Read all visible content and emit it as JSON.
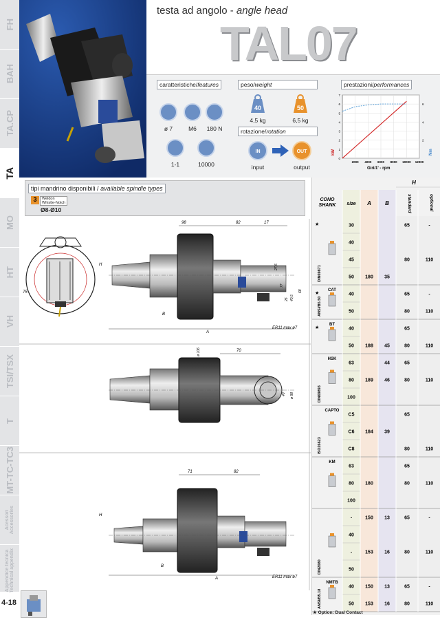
{
  "nav": {
    "tabs": [
      "FH",
      "BAH",
      "TA.CP",
      "TA",
      "MO",
      "HT",
      "VH",
      "TSI/TSX",
      "T",
      "MT-TC-TC3",
      "Acessori\nAccessories",
      "Appendice tecnica\nTechnical appendix"
    ],
    "active": "TA",
    "page_number": "4-18"
  },
  "header": {
    "subtitle_it": "testa ad angolo -",
    "subtitle_en": "angle head",
    "model": "TAL07"
  },
  "features": {
    "title_it": "caratteristiche/",
    "title_en": "features",
    "items": [
      "ø 7",
      "M6",
      "180 N",
      "1-1",
      "10000"
    ],
    "icons": [
      "collet-icon",
      "thread-icon",
      "force-icon",
      "ratio-icon",
      "rpm-icon"
    ]
  },
  "weight": {
    "title_it": "peso/",
    "title_en": "weight",
    "items": [
      "4,5 kg",
      "6,5 kg"
    ],
    "badges": [
      "40",
      "50"
    ]
  },
  "rotation": {
    "title_it": "rotazione/",
    "title_en": "rotation",
    "input": "input",
    "output": "output",
    "badge_in": "IN",
    "badge_out": "OUT"
  },
  "performance": {
    "title_it": "prestazioni/",
    "title_en": "performances",
    "xlabel": "Giri/1' - rpm",
    "ylabel_left": "kW",
    "ylabel_right": "Nm"
  },
  "chart_data": {
    "type": "line",
    "x": [
      0,
      2000,
      4000,
      6000,
      8000,
      10000,
      12000
    ],
    "xlim": [
      0,
      12000
    ],
    "xticks": [
      "2000",
      "4000",
      "6000",
      "8000",
      "10000",
      "12000"
    ],
    "ylim_left": [
      0,
      7
    ],
    "yticks_left": [
      "0",
      "1",
      "2",
      "3",
      "4",
      "5",
      "6",
      "7"
    ],
    "ylim_right": [
      0,
      7
    ],
    "yticks_right": [
      "2",
      "4",
      "6"
    ],
    "series": [
      {
        "axis": "left",
        "color": "#d42a2a",
        "points": [
          [
            0,
            0
          ],
          [
            10000,
            6.3
          ]
        ]
      },
      {
        "axis": "right",
        "color": "#5aa0d8",
        "dashed": true,
        "points": [
          [
            0,
            5.2
          ],
          [
            2000,
            5.7
          ],
          [
            4000,
            5.9
          ],
          [
            6000,
            6
          ],
          [
            8000,
            6
          ],
          [
            10000,
            6
          ]
        ]
      }
    ]
  },
  "spindle": {
    "title_it": "tipi mandrino disponibili /",
    "title_en": "available spindle types",
    "badge": "3",
    "badge_text": "Weldon\nWhistle-Notch",
    "range": "Ø8-Ø10"
  },
  "drawings": {
    "dims1": [
      "98",
      "82",
      "17",
      "H",
      "B",
      "A",
      "75",
      "27,5",
      "77",
      "26",
      "40,5",
      "68"
    ],
    "er_label": "ER11 max ø7",
    "dims2": [
      "70",
      "ø 106",
      "40",
      "ø 98"
    ],
    "dims3": [
      "71",
      "82",
      "H",
      "B",
      "A"
    ]
  },
  "table": {
    "header": {
      "cono": "CONO",
      "shank": "SHANK",
      "size": "size",
      "A": "A",
      "B": "B",
      "H": "H",
      "standard": "standard",
      "optional": "optional"
    },
    "groups": [
      {
        "name": "DIN69871",
        "star": true,
        "label": ""
      },
      {
        "name": "ANSI/B5.50",
        "star": true,
        "label": "CAT"
      },
      {
        "name": "",
        "star": true,
        "label": "BT"
      },
      {
        "name": "DIN69893",
        "star": false,
        "label": "HSK"
      },
      {
        "name": "ISO26623",
        "star": false,
        "label": "CAPTO"
      },
      {
        "name": "",
        "star": false,
        "label": "KM"
      },
      {
        "name": "DIN2080",
        "star": false,
        "label": ""
      },
      {
        "name": "ANSI/B5.18",
        "star": false,
        "label": "NMTB"
      }
    ],
    "rows": [
      {
        "size": "30",
        "A": "",
        "B": "",
        "std": "65",
        "opt": "-"
      },
      {
        "size": "40",
        "A": "",
        "B": "",
        "std": "",
        "opt": ""
      },
      {
        "size": "45",
        "A": "",
        "B": "",
        "std": "80",
        "opt": "110"
      },
      {
        "size": "50",
        "A": "180",
        "B": "35",
        "std": "",
        "opt": ""
      },
      {
        "size": "40",
        "A": "",
        "B": "",
        "std": "65",
        "opt": "-"
      },
      {
        "size": "50",
        "A": "",
        "B": "",
        "std": "80",
        "opt": "110"
      },
      {
        "size": "40",
        "A": "",
        "B": "",
        "std": "65",
        "opt": ""
      },
      {
        "size": "50",
        "A": "188",
        "B": "45",
        "std": "80",
        "opt": "110"
      },
      {
        "size": "63",
        "A": "",
        "B": "44",
        "std": "65",
        "opt": ""
      },
      {
        "size": "80",
        "A": "189",
        "B": "46",
        "std": "80",
        "opt": "110"
      },
      {
        "size": "100",
        "A": "",
        "B": "",
        "std": "",
        "opt": ""
      },
      {
        "size": "C5",
        "A": "",
        "B": "",
        "std": "65",
        "opt": ""
      },
      {
        "size": "C6",
        "A": "184",
        "B": "39",
        "std": "",
        "opt": ""
      },
      {
        "size": "C8",
        "A": "",
        "B": "",
        "std": "80",
        "opt": "110"
      },
      {
        "size": "63",
        "A": "",
        "B": "",
        "std": "65",
        "opt": ""
      },
      {
        "size": "80",
        "A": "180",
        "B": "",
        "std": "80",
        "opt": "110"
      },
      {
        "size": "100",
        "A": "",
        "B": "",
        "std": "",
        "opt": ""
      },
      {
        "size": "-",
        "A": "150",
        "B": "13",
        "std": "65",
        "opt": "-"
      },
      {
        "size": "40",
        "A": "",
        "B": "",
        "std": "",
        "opt": ""
      },
      {
        "size": "-",
        "A": "153",
        "B": "16",
        "std": "80",
        "opt": "110"
      },
      {
        "size": "50",
        "A": "",
        "B": "",
        "std": "",
        "opt": ""
      },
      {
        "size": "40",
        "A": "150",
        "B": "13",
        "std": "65",
        "opt": "-"
      },
      {
        "size": "50",
        "A": "153",
        "B": "16",
        "std": "80",
        "opt": "110"
      }
    ],
    "footnote": "★ Option: Dual Contact"
  }
}
